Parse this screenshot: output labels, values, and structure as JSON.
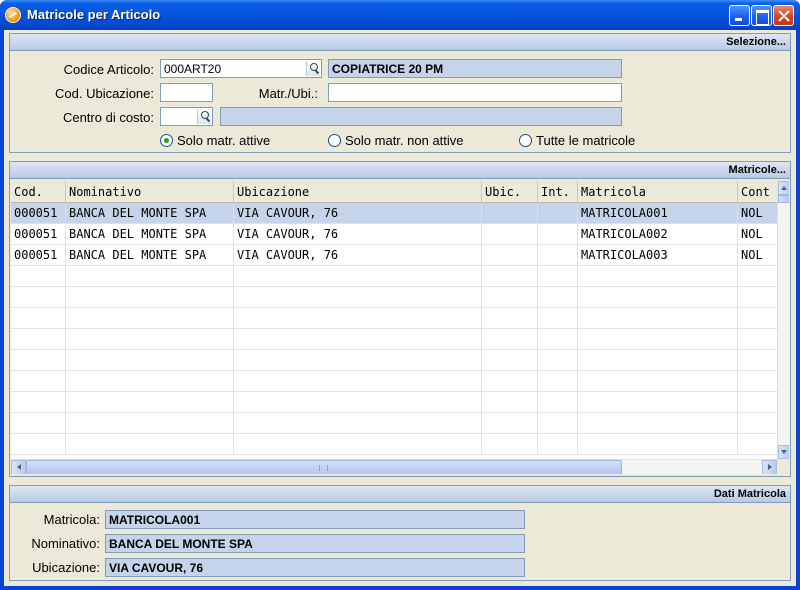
{
  "window": {
    "title": "Matricole per Articolo"
  },
  "selection": {
    "header": "Selezione...",
    "codice_articolo_label": "Codice Articolo:",
    "codice_articolo_value": "000ART20",
    "articolo_descrizione": "COPIATRICE 20 PM",
    "cod_ubicazione_label": "Cod. Ubicazione:",
    "cod_ubicazione_value": "",
    "matr_ubi_label": "Matr./Ubi.:",
    "matr_ubi_value": "",
    "centro_costo_label": "Centro di costo:",
    "centro_costo_value": "",
    "centro_costo_descrizione": "",
    "radio_options": [
      {
        "label": "Solo matr. attive",
        "selected": true
      },
      {
        "label": "Solo matr. non attive",
        "selected": false
      },
      {
        "label": "Tutte le matricole",
        "selected": false
      }
    ]
  },
  "grid": {
    "header": "Matricole...",
    "columns": [
      "Cod.",
      "Nominativo",
      "Ubicazione",
      "Ubic.",
      "Int.",
      "Matricola",
      "Cont"
    ],
    "rows": [
      [
        "000051",
        "BANCA DEL MONTE SPA",
        "VIA CAVOUR, 76",
        "",
        "",
        "MATRICOLA001",
        "NOL"
      ],
      [
        "000051",
        "BANCA DEL MONTE SPA",
        "VIA CAVOUR, 76",
        "",
        "",
        "MATRICOLA002",
        "NOL"
      ],
      [
        "000051",
        "BANCA DEL MONTE SPA",
        "VIA CAVOUR, 76",
        "",
        "",
        "MATRICOLA003",
        "NOL"
      ]
    ],
    "selected_row": 0
  },
  "details": {
    "header": "Dati Matricola",
    "matricola_label": "Matricola:",
    "matricola_value": "MATRICOLA001",
    "nominativo_label": "Nominativo:",
    "nominativo_value": "BANCA DEL MONTE SPA",
    "ubicazione_label": "Ubicazione:",
    "ubicazione_value": "VIA CAVOUR, 76"
  }
}
